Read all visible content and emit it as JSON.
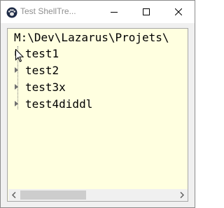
{
  "window": {
    "title": "Test ShellTre...",
    "icon": "lazarus-paw-icon"
  },
  "titlebar_buttons": {
    "minimize_icon": "minimize-icon",
    "maximize_icon": "maximize-icon",
    "close_icon": "close-icon"
  },
  "tree": {
    "root_path": "M:\\Dev\\Lazarus\\Projets\\",
    "background_color": "#ffffe0",
    "items": [
      {
        "label": "test1",
        "expandable": true
      },
      {
        "label": "test2",
        "expandable": true
      },
      {
        "label": "test3x",
        "expandable": true
      },
      {
        "label": "test4diddl",
        "expandable": true
      }
    ]
  },
  "scrollbar": {
    "horizontal": true,
    "thumb_position": 0.0,
    "visible_fraction": 0.42
  }
}
